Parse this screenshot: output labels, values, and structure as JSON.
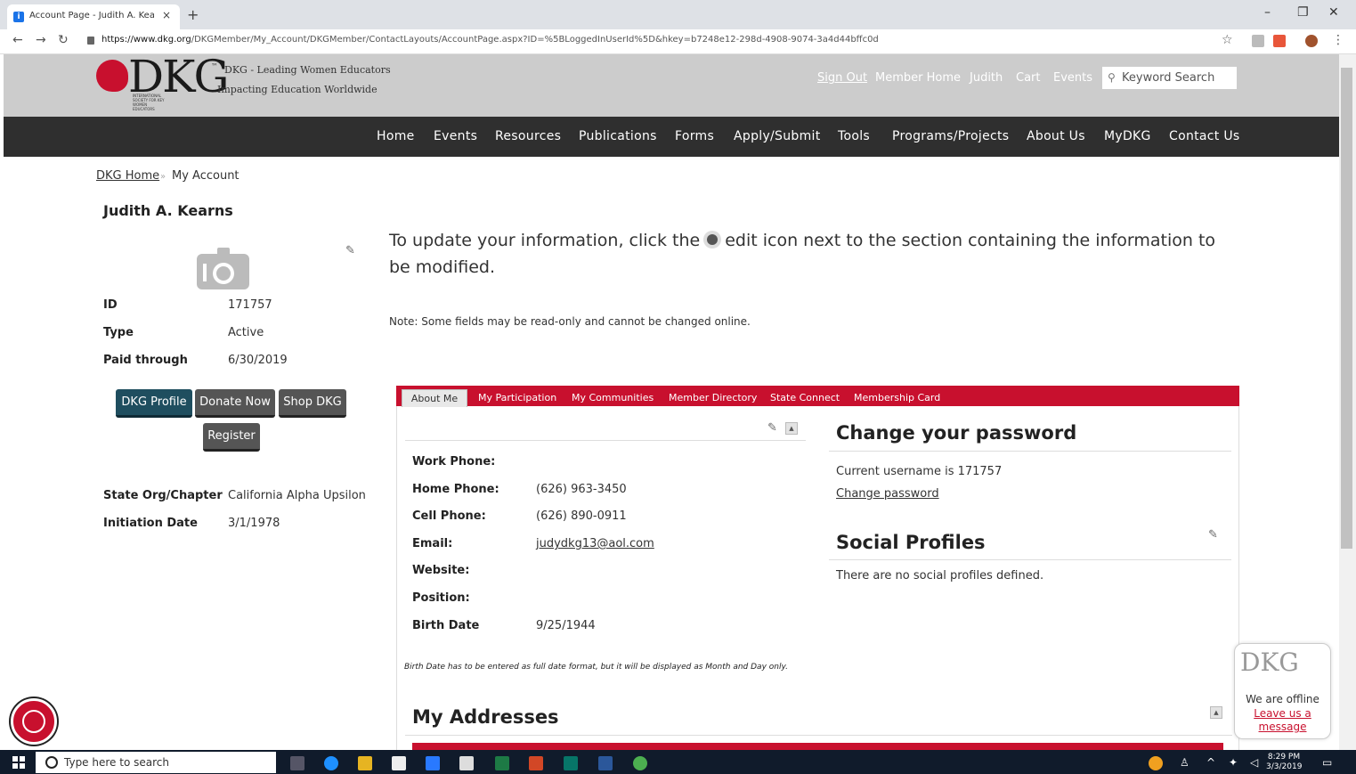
{
  "browser": {
    "tab_title": "Account Page - Judith A. Kearns",
    "tab_close": "×",
    "new_tab": "+",
    "url_domain": "https://www.dkg.org",
    "url_path": "/DKGMember/My_Account/DKGMember/ContactLayouts/AccountPage.aspx?ID=%5BLoggedInUserId%5D&hkey=b7248e12-298d-4908-9074-3a4d44bffc0d"
  },
  "header": {
    "logo_text": "DKG",
    "logo_tm": "™",
    "tagline1": "DKG - Leading Women Educators",
    "tagline2": "Impacting Education Worldwide",
    "logo_small": "INTERNATIONAL SOCIETY FOR KEY WOMEN EDUCATORS",
    "links": [
      "Sign Out",
      "Member Home",
      "Judith",
      "Cart",
      "Events"
    ],
    "search_placeholder": "Keyword Search"
  },
  "nav": [
    "Home",
    "Events",
    "Resources",
    "Publications",
    "Forms",
    "Apply/Submit",
    "Tools",
    "Programs/Projects",
    "About Us",
    "MyDKG",
    "Contact Us"
  ],
  "breadcrumb": {
    "home": "DKG Home",
    "sep": "»",
    "current": "My Account"
  },
  "profile": {
    "name": "Judith A. Kearns",
    "rows": [
      {
        "label": "ID",
        "value": "171757"
      },
      {
        "label": "Type",
        "value": "Active"
      },
      {
        "label": "Paid through",
        "value": "6/30/2019"
      }
    ],
    "buttons": [
      "DKG Profile",
      "Donate Now",
      "Shop DKG",
      "Register"
    ],
    "rows2": [
      {
        "label": "State Org/Chapter",
        "value": "California Alpha Upsilon"
      },
      {
        "label": "Initiation Date",
        "value": "3/1/1978"
      }
    ]
  },
  "intro": {
    "before": "To update your information, click the",
    "after": "edit icon next to the section containing the information to be modified.",
    "note": "Note: Some fields may be read-only and cannot be changed online."
  },
  "tabs": [
    "About Me",
    "My Participation",
    "My Communities",
    "Member Directory",
    "State Connect",
    "Membership Card"
  ],
  "contact": {
    "fields": [
      {
        "label": "Work Phone:",
        "value": ""
      },
      {
        "label": "Home Phone:",
        "value": "(626) 963-3450"
      },
      {
        "label": "Cell Phone:",
        "value": "(626) 890-0911"
      },
      {
        "label": "Email:",
        "value": "judydkg13@aol.com"
      },
      {
        "label": "Website:",
        "value": ""
      },
      {
        "label": "Position:",
        "value": ""
      },
      {
        "label": "Birth Date",
        "value": "9/25/1944"
      }
    ],
    "fine_print": "Birth Date has to be entered as full date format, but it will be displayed as Month and Day only."
  },
  "password": {
    "title": "Change your password",
    "username_line": "Current username is  171757",
    "link": "Change password"
  },
  "social": {
    "title": "Social Profiles",
    "empty": "There are no social profiles defined."
  },
  "addresses": {
    "title": "My Addresses"
  },
  "chat": {
    "logo": "DKG",
    "status": "We are offline",
    "message": "Leave us a message"
  },
  "taskbar": {
    "search_placeholder": "Type here to search",
    "time": "8:29 PM",
    "date": "3/3/2019"
  },
  "colors": {
    "brand_red": "#c8102e",
    "nav_dark": "#2f2f2f",
    "button_teal": "#1f4e5f"
  },
  "icons": [
    "camera-icon",
    "pencil-icon",
    "search-icon",
    "accessibility-icon",
    "lock-icon",
    "windows-icon"
  ]
}
